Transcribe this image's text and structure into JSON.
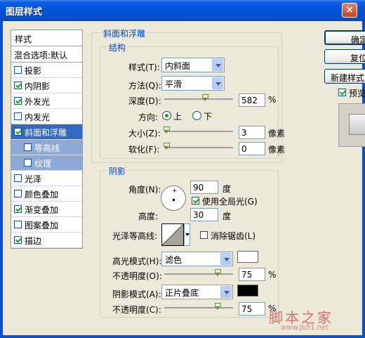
{
  "window": {
    "title": "图层样式",
    "close": "×"
  },
  "sidebar": {
    "header": "样式",
    "blend": "混合选项:默认",
    "items": [
      {
        "label": "投影",
        "checked": false
      },
      {
        "label": "内阴影",
        "checked": true
      },
      {
        "label": "外发光",
        "checked": true
      },
      {
        "label": "内发光",
        "checked": false
      },
      {
        "label": "斜面和浮雕",
        "checked": true,
        "selected": true
      },
      {
        "label": "等高线",
        "checked": false,
        "sub": true
      },
      {
        "label": "纹理",
        "checked": false,
        "sub": true
      },
      {
        "label": "光泽",
        "checked": false
      },
      {
        "label": "颜色叠加",
        "checked": false
      },
      {
        "label": "渐变叠加",
        "checked": true
      },
      {
        "label": "图案叠加",
        "checked": false
      },
      {
        "label": "描边",
        "checked": true
      }
    ]
  },
  "bevel": {
    "legend": "斜面和浮雕",
    "structure": {
      "legend": "结构",
      "style_label": "样式(T):",
      "style_value": "内斜面",
      "technique_label": "方法(Q):",
      "technique_value": "平滑",
      "depth_label": "深度(D):",
      "depth_value": "582",
      "depth_unit": "%",
      "direction_label": "方向:",
      "dir_up": "上",
      "dir_down": "下",
      "size_label": "大小(Z):",
      "size_value": "3",
      "size_unit": "像素",
      "soften_label": "软化(F):",
      "soften_value": "0",
      "soften_unit": "像素"
    },
    "shading": {
      "legend": "阴影",
      "angle_label": "角度(N):",
      "angle_value": "90",
      "angle_unit": "度",
      "global_light": "使用全局光(G)",
      "global_light_checked": true,
      "altitude_label": "高度:",
      "altitude_value": "30",
      "altitude_unit": "度",
      "gloss_label": "光泽等高线:",
      "antialias": "消除锯齿(L)",
      "antialias_checked": false,
      "highlight_label": "高光模式(H):",
      "highlight_mode": "滤色",
      "highlight_color": "#FFFFFF",
      "hl_opacity_label": "不透明度(O):",
      "hl_opacity_value": "75",
      "hl_opacity_unit": "%",
      "shadow_label": "阴影模式(A):",
      "shadow_mode": "正片叠底",
      "shadow_color": "#000000",
      "sh_opacity_label": "不透明度(C):",
      "sh_opacity_value": "75",
      "sh_opacity_unit": "%"
    }
  },
  "buttons": {
    "ok": "确定",
    "reset": "复位",
    "new_style": "新建样式",
    "preview": "预览",
    "preview_checked": true
  },
  "watermark": {
    "main": "脚本之家",
    "sub": "www.jb51.net"
  }
}
